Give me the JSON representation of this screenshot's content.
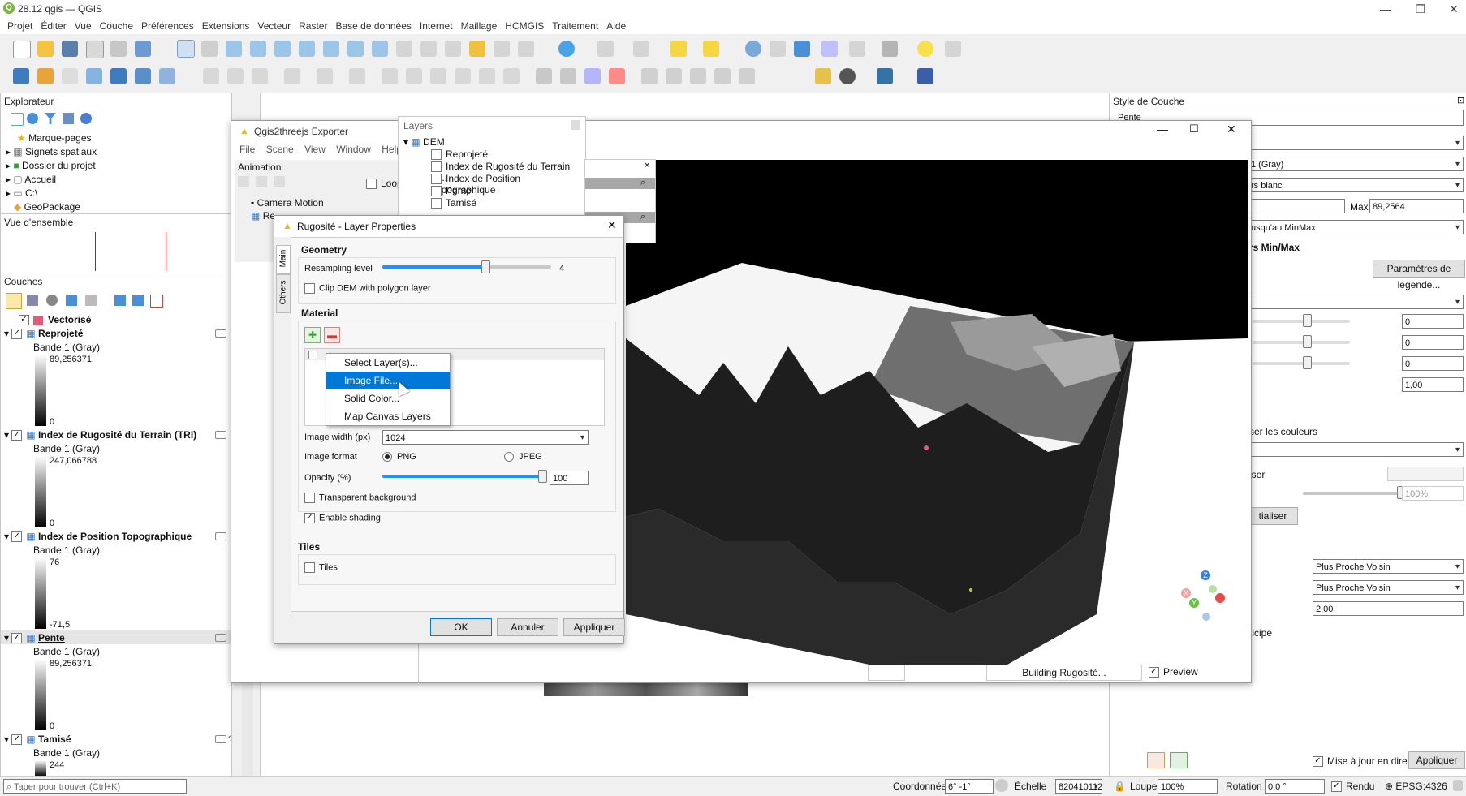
{
  "window": {
    "title": "28.12 qgis — QGIS",
    "app_icon": "Q"
  },
  "menu": [
    "Projet",
    "Éditer",
    "Vue",
    "Couche",
    "Préférences",
    "Extensions",
    "Vecteur",
    "Raster",
    "Base de données",
    "Internet",
    "Maillage",
    "HCMGIS",
    "Traitement",
    "Aide"
  ],
  "explorer": {
    "title": "Explorateur",
    "items": [
      "Marque-pages",
      "Signets spatiaux",
      "Dossier du projet",
      "Accueil",
      "C:\\",
      "GeoPackage"
    ]
  },
  "overview": {
    "title": "Vue d'ensemble"
  },
  "layers": {
    "title": "Couches",
    "items": [
      {
        "name": "Vectorisé"
      },
      {
        "name": "Reprojeté",
        "band": "Bande 1 (Gray)",
        "max": "89,256371",
        "min": "0"
      },
      {
        "name": "Index de Rugosité du Terrain (TRI)",
        "band": "Bande 1 (Gray)",
        "max": "247,066788",
        "min": "0"
      },
      {
        "name": "Index de Position Topographique",
        "band": "Bande 1 (Gray)",
        "max": "76",
        "min": "-71,5"
      },
      {
        "name": "Pente",
        "band": "Bande 1 (Gray)",
        "max": "89,256371",
        "min": "0"
      },
      {
        "name": "Tamisé",
        "band": "Bande 1 (Gray)",
        "max": "244"
      }
    ]
  },
  "exporter": {
    "title": "Qgis2threejs Exporter",
    "menu": [
      "File",
      "Scene",
      "View",
      "Window",
      "Help"
    ],
    "animation_title": "Animation",
    "loop_label": "Loop",
    "tree": [
      "Camera Motion",
      "Re"
    ],
    "status": "Building Rugosité...",
    "preview_label": "Preview"
  },
  "layers_panel": {
    "title": "Layers",
    "group": "DEM",
    "items": [
      "Reprojeté",
      "Index de Rugosité du Terrain (T...",
      "Index de Position Topographique",
      "Pente",
      "Tamisé"
    ]
  },
  "dialog": {
    "title": "Rugosité - Layer Properties",
    "tabs": [
      "Main",
      "Others"
    ],
    "geometry": {
      "title": "Geometry",
      "resampling_label": "Resampling level",
      "resampling_value": "4",
      "clip_label": "Clip DEM with polygon layer"
    },
    "material": {
      "title": "Material",
      "popup": [
        "Select Layer(s)...",
        "Image File...",
        "Solid Color...",
        "Map Canvas Layers"
      ],
      "selected_index": 1,
      "image_width_label": "Image width (px)",
      "image_width_value": "1024",
      "image_format_label": "Image format",
      "format_png": "PNG",
      "format_jpeg": "JPEG",
      "opacity_label": "Opacity (%)",
      "opacity_value": "100",
      "transparent_label": "Transparent background",
      "shading_label": "Enable shading"
    },
    "tiles": {
      "title": "Tiles",
      "label": "Tiles"
    },
    "buttons": {
      "ok": "OK",
      "cancel": "Annuler",
      "apply": "Appliquer"
    }
  },
  "style_panel": {
    "title": "Style de Couche",
    "layer": "Pente",
    "band": "1 (Gray)",
    "gradient": "rs blanc",
    "max_label": "Max",
    "max_value": "89,2564",
    "range_mode": "usqu'au MinMax",
    "minmax_title": "rs Min/Max",
    "legend_button": "Paramètres de légende...",
    "values": [
      "0",
      "0",
      "0",
      "1,00"
    ],
    "colorize_label": "ser les couleurs",
    "ise_label": "iser",
    "percent": "100%",
    "reset_button": "tialiser",
    "resampling1": "Plus Proche Voisin",
    "resampling2": "Plus Proche Voisin",
    "oversampling": "2,00",
    "early_label": "ticipé",
    "live_update": "Mise à jour en direct",
    "apply": "Appliquer"
  },
  "statusbar": {
    "search_placeholder": "Taper pour trouver (Ctrl+K)",
    "coord_label": "Coordonnée",
    "coord_value": "6° -1°",
    "scale_label": "Échelle",
    "scale_value": "820410112",
    "magnifier_label": "Loupe",
    "magnifier_value": "100%",
    "rotation_label": "Rotation",
    "rotation_value": "0,0 °",
    "render_label": "Rendu",
    "crs": "EPSG:4326"
  }
}
